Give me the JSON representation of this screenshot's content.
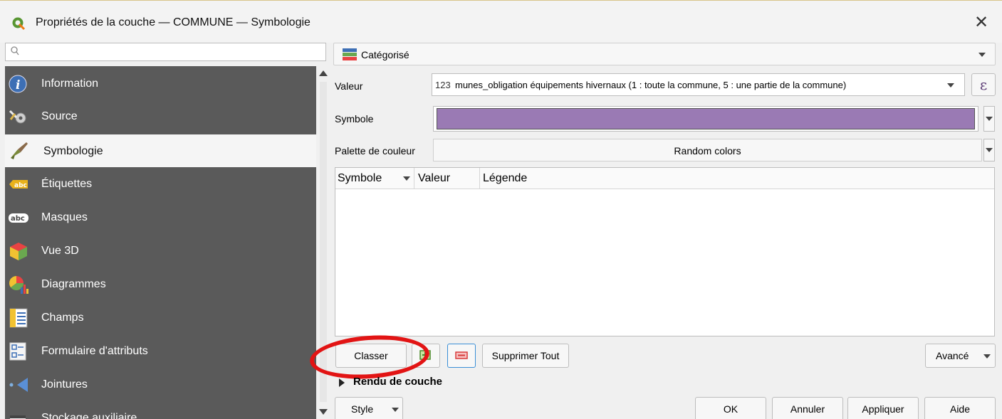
{
  "window": {
    "title": "Propriétés de la couche — COMMUNE — Symbologie",
    "close_glyph": "✕"
  },
  "search": {
    "placeholder": ""
  },
  "sidebar": {
    "items": [
      {
        "label": "Information",
        "icon": "info-icon"
      },
      {
        "label": "Source",
        "icon": "source-icon"
      },
      {
        "label": "Symbologie",
        "icon": "paintbrush-icon",
        "active": true
      },
      {
        "label": "Étiquettes",
        "icon": "labels-abc-icon"
      },
      {
        "label": "Masques",
        "icon": "masks-abc-icon"
      },
      {
        "label": "Vue 3D",
        "icon": "cube-3d-icon"
      },
      {
        "label": "Diagrammes",
        "icon": "diagrams-icon"
      },
      {
        "label": "Champs",
        "icon": "fields-icon"
      },
      {
        "label": "Formulaire d'attributs",
        "icon": "form-icon"
      },
      {
        "label": "Jointures",
        "icon": "joins-icon"
      },
      {
        "label": "Stockage auxiliaire",
        "icon": "storage-icon"
      }
    ]
  },
  "renderer": {
    "label": "Catégorisé",
    "icon": "categorized-icon"
  },
  "form": {
    "valeur_label": "Valeur",
    "valeur_type": "123",
    "valeur_value": "munes_obligation équipements hivernaux (1 : toute la commune, 5 : une partie de la commune)",
    "expression_glyph": "ε",
    "symbole_label": "Symbole",
    "symbole_color": "#9a7ab4",
    "palette_label": "Palette de couleur",
    "palette_value": "Random colors"
  },
  "table": {
    "columns": [
      "Symbole",
      "Valeur",
      "Légende"
    ],
    "rows": []
  },
  "actions": {
    "classer": "Classer",
    "supprimer_tout": "Supprimer Tout",
    "avance": "Avancé"
  },
  "rendu": {
    "label": "Rendu de couche"
  },
  "footer": {
    "style": "Style",
    "ok": "OK",
    "annuler": "Annuler",
    "appliquer": "Appliquer",
    "aide": "Aide"
  },
  "colors": {
    "sidebar_bg": "#5a5a5a",
    "highlight_ellipse": "#e21414",
    "accent": "#3a8fd6"
  }
}
